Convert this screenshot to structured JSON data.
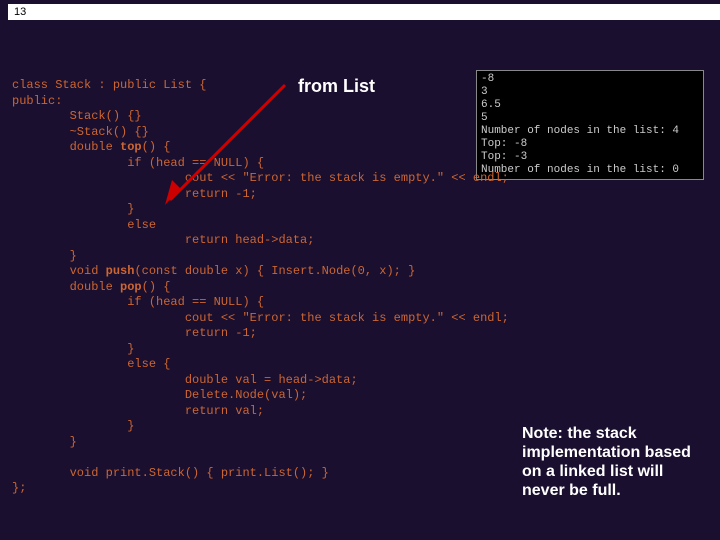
{
  "slide_number": "13",
  "code_text": "class Stack : public List {\npublic:\n        Stack() {}\n        ~Stack() {}\n        double top() {\n                if (head == NULL) {\n                        cout << \"Error: the stack is empty.\" << endl;\n                        return -1;\n                }\n                else\n                        return head->data;\n        }\n        void push(const double x) { Insert.Node(0, x); }\n        double pop() {\n                if (head == NULL) {\n                        cout << \"Error: the stack is empty.\" << endl;\n                        return -1;\n                }\n                else {\n                        double val = head->data;\n                        Delete.Node(val);\n                        return val;\n                }\n        }\n\n        void print.Stack() { print.List(); }\n};",
  "kw_top": "top",
  "kw_push": "push",
  "kw_pop": "pop",
  "annotation_label": "from List",
  "console_output": "-8\n3\n6.5\n5\nNumber of nodes in the list: 4\nTop: -8\nTop: -3\nNumber of nodes in the list: 0",
  "note_text": "Note: the stack implementation based on a linked list will never be full."
}
